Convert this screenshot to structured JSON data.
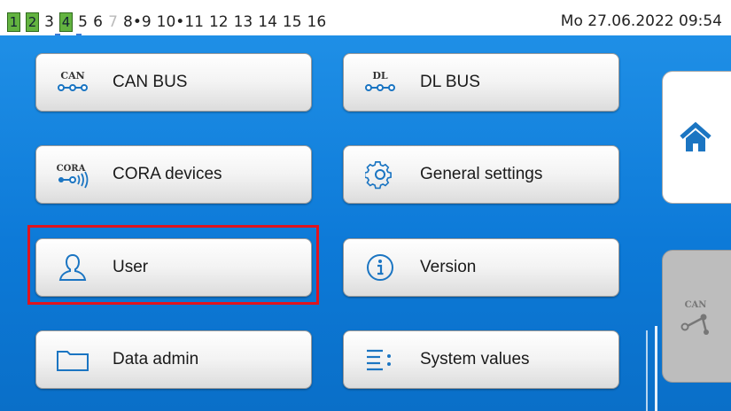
{
  "status_bar": {
    "outputs": [
      {
        "label": "1",
        "state": "on"
      },
      {
        "label": "2",
        "state": "on"
      },
      {
        "label": "3",
        "state": "normal"
      },
      {
        "label": "4",
        "state": "on"
      },
      {
        "label": "5",
        "state": "normal"
      },
      {
        "label": "6",
        "state": "normal"
      },
      {
        "label": "7",
        "state": "dim"
      },
      {
        "label": "8•9",
        "state": "normal"
      },
      {
        "label": "10•11",
        "state": "normal"
      },
      {
        "label": "12",
        "state": "normal"
      },
      {
        "label": "13",
        "state": "normal"
      },
      {
        "label": "14",
        "state": "normal"
      },
      {
        "label": "15",
        "state": "normal"
      },
      {
        "label": "16",
        "state": "normal"
      }
    ],
    "datetime": "Mo 27.06.2022 09:54"
  },
  "menu": {
    "can_bus": {
      "label": "CAN BUS",
      "icon": "can-bus-icon",
      "icon_text": "CAN"
    },
    "dl_bus": {
      "label": "DL BUS",
      "icon": "dl-bus-icon",
      "icon_text": "DL"
    },
    "cora_devices": {
      "label": "CORA devices",
      "icon": "cora-icon",
      "icon_text": "CORA"
    },
    "general_settings": {
      "label": "General settings",
      "icon": "gear-icon"
    },
    "user": {
      "label": "User",
      "icon": "user-icon"
    },
    "version": {
      "label": "Version",
      "icon": "info-icon"
    },
    "data_admin": {
      "label": "Data admin",
      "icon": "folder-icon"
    },
    "system_values": {
      "label": "System values",
      "icon": "list-icon"
    }
  },
  "side": {
    "home": {
      "icon": "home-icon"
    },
    "can_network": {
      "icon": "can-network-icon",
      "icon_text": "CAN"
    }
  },
  "colors": {
    "highlight": "#e0141e",
    "background": "#1586e0",
    "accent_blue": "#1b75c2",
    "output_on": "#63b340"
  }
}
